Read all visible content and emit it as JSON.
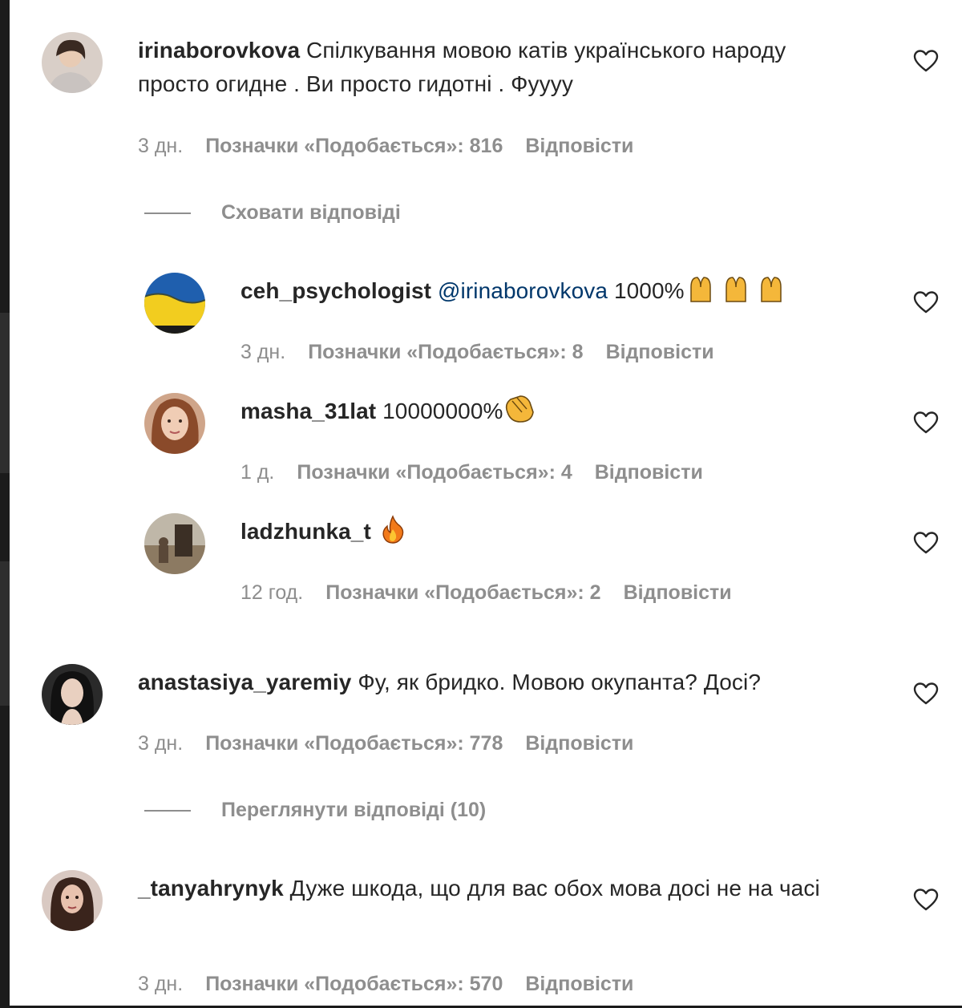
{
  "comments": [
    {
      "username": "irinaborovkova",
      "text": "Спілкування мовою катів українського народу просто огидне . Ви просто гидотні . Фуууу",
      "time": "3 дн.",
      "likes": "Позначки «Подобається»: 816",
      "reply": "Відповісти",
      "toggle": "Сховати відповіді",
      "replies": [
        {
          "username": "ceh_psychologist",
          "mention": "@irinaborovkova",
          "text": "1000%",
          "emoji": "raising-hands-icon",
          "time": "3 дн.",
          "likes": "Позначки «Подобається»: 8",
          "reply": "Відповісти"
        },
        {
          "username": "masha_31lat",
          "text": "10000000%",
          "emoji": "clapping-hands-icon",
          "time": "1 д.",
          "likes": "Позначки «Подобається»: 4",
          "reply": "Відповісти"
        },
        {
          "username": "ladzhunka_t",
          "text": "",
          "emoji": "fire-icon",
          "time": "12 год.",
          "likes": "Позначки «Подобається»: 2",
          "reply": "Відповісти"
        }
      ]
    },
    {
      "username": "anastasiya_yaremiy",
      "text": "Фу, як бридко. Мовою окупанта? Досі?",
      "time": "3 дн.",
      "likes": "Позначки «Подобається»: 778",
      "reply": "Відповісти",
      "toggle": "Переглянути відповіді (10)"
    },
    {
      "username": "_tanyahrynyk",
      "text": "Дуже шкода, що для вас обох мова досі не на часі",
      "time": "3 дн.",
      "likes": "Позначки «Подобається»: 570",
      "reply": "Відповісти"
    }
  ],
  "icons": {
    "like": "heart-outline-icon"
  },
  "colors": {
    "text": "#262626",
    "meta": "#8e8e8e",
    "mention": "#00376b"
  }
}
